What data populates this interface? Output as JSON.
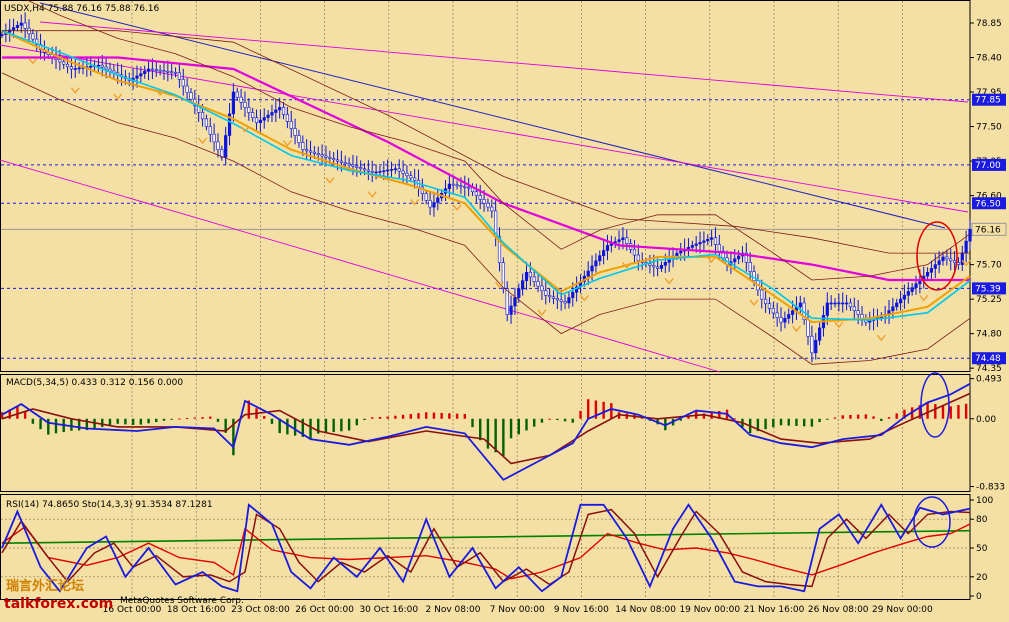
{
  "app": {
    "colors": {
      "background": "#f4e0a4",
      "grid": "#8a7a5a",
      "candle": "#0a14e0",
      "support_line": "#2020c0",
      "ma_magenta": "#e000e0",
      "ma_orange": "#f0a000",
      "ma_cyan": "#00c8e8",
      "band": "#7a1a1a",
      "fractal": "#f0a030",
      "macd_pos": "#e00000",
      "macd_neg": "#006000",
      "macd_line": "#1a1ae0",
      "signal_line": "#8a1010",
      "rsi_line": "#e00000",
      "sto_main": "#1a1ae0",
      "sto_signal": "#8a1010",
      "trend": "#008000",
      "highlight_red": "#e00000",
      "highlight_blue": "#1a1ae0"
    }
  },
  "chart_data": [
    {
      "type": "candlestick",
      "panel": "price",
      "header": "USDX,H4  75.88 76.16 75.88 76.16",
      "y_ticks": [
        "78.85",
        "78.40",
        "77.95",
        "77.50",
        "77.05",
        "76.60",
        "76.15",
        "75.70",
        "75.25",
        "74.80",
        "74.35"
      ],
      "ylim": [
        74.3,
        79.15
      ],
      "horizontal_levels": [
        {
          "value": 77.85,
          "label": "77.85"
        },
        {
          "value": 77.0,
          "label": "77.00"
        },
        {
          "value": 76.5,
          "label": "76.50"
        },
        {
          "value": 76.16,
          "label": "76.16",
          "current": true
        },
        {
          "value": 75.39,
          "label": "75.39"
        },
        {
          "value": 74.48,
          "label": "74.48"
        }
      ],
      "x_ticks": [
        "16 Oct 00:00",
        "18 Oct 16:00",
        "23 Oct 08:00",
        "26 Oct 00:00",
        "30 Oct 16:00",
        "2 Nov 08:00",
        "7 Nov 00:00",
        "9 Nov 16:00",
        "14 Nov 08:00",
        "19 Nov 00:00",
        "21 Nov 16:00",
        "26 Nov 08:00",
        "29 Nov 00:00"
      ],
      "close_path": [
        [
          0,
          78.7
        ],
        [
          5,
          78.85
        ],
        [
          10,
          78.5
        ],
        [
          18,
          78.25
        ],
        [
          25,
          78.3
        ],
        [
          33,
          78.1
        ],
        [
          38,
          78.25
        ],
        [
          45,
          78.2
        ],
        [
          52,
          77.6
        ],
        [
          57,
          77.1
        ],
        [
          60,
          77.95
        ],
        [
          66,
          77.55
        ],
        [
          72,
          77.75
        ],
        [
          78,
          77.2
        ],
        [
          84,
          77.1
        ],
        [
          90,
          77.0
        ],
        [
          96,
          76.9
        ],
        [
          102,
          76.95
        ],
        [
          107,
          76.8
        ],
        [
          111,
          76.45
        ],
        [
          116,
          76.75
        ],
        [
          121,
          76.7
        ],
        [
          127,
          76.4
        ],
        [
          131,
          75.05
        ],
        [
          136,
          75.6
        ],
        [
          141,
          75.3
        ],
        [
          146,
          75.2
        ],
        [
          151,
          75.55
        ],
        [
          157,
          75.95
        ],
        [
          161,
          76.05
        ],
        [
          165,
          75.75
        ],
        [
          170,
          75.65
        ],
        [
          175,
          75.85
        ],
        [
          179,
          75.95
        ],
        [
          184,
          76.05
        ],
        [
          188,
          75.7
        ],
        [
          192,
          75.85
        ],
        [
          197,
          75.25
        ],
        [
          202,
          74.95
        ],
        [
          207,
          75.2
        ],
        [
          210,
          74.55
        ],
        [
          214,
          75.2
        ],
        [
          219,
          75.2
        ],
        [
          224,
          74.95
        ],
        [
          229,
          75.05
        ],
        [
          234,
          75.3
        ],
        [
          239,
          75.55
        ],
        [
          244,
          75.8
        ],
        [
          248,
          75.7
        ],
        [
          251,
          76.16
        ]
      ],
      "overlays": [
        {
          "name": "MA magenta",
          "points": [
            [
              0,
              78.4
            ],
            [
              30,
              78.4
            ],
            [
              60,
              78.25
            ],
            [
              100,
              77.3
            ],
            [
              130,
              76.5
            ],
            [
              160,
              75.95
            ],
            [
              190,
              75.85
            ],
            [
              210,
              75.7
            ],
            [
              230,
              75.5
            ],
            [
              251,
              75.5
            ]
          ]
        },
        {
          "name": "MA orange",
          "points": [
            [
              0,
              78.75
            ],
            [
              15,
              78.4
            ],
            [
              30,
              78.1
            ],
            [
              45,
              77.9
            ],
            [
              60,
              77.6
            ],
            [
              75,
              77.2
            ],
            [
              90,
              76.95
            ],
            [
              105,
              76.75
            ],
            [
              120,
              76.5
            ],
            [
              130,
              75.95
            ],
            [
              145,
              75.35
            ],
            [
              155,
              75.6
            ],
            [
              170,
              75.8
            ],
            [
              185,
              75.8
            ],
            [
              200,
              75.3
            ],
            [
              210,
              74.95
            ],
            [
              225,
              75.0
            ],
            [
              240,
              75.15
            ],
            [
              251,
              75.55
            ]
          ]
        }
      ]
    },
    {
      "type": "bar",
      "panel": "macd",
      "header": "MACD(5,34,5) 0.433 0.312 0.156 0.000",
      "y_ticks": [
        "0.493",
        "0.00",
        "-0.833"
      ],
      "ylim": [
        -0.9,
        0.55
      ],
      "macd_line": [
        [
          0,
          0.05
        ],
        [
          5,
          0.18
        ],
        [
          12,
          -0.05
        ],
        [
          22,
          -0.12
        ],
        [
          35,
          -0.15
        ],
        [
          45,
          -0.1
        ],
        [
          55,
          -0.12
        ],
        [
          60,
          -0.35
        ],
        [
          63,
          0.22
        ],
        [
          70,
          0.05
        ],
        [
          80,
          -0.25
        ],
        [
          90,
          -0.32
        ],
        [
          100,
          -0.22
        ],
        [
          110,
          -0.1
        ],
        [
          120,
          -0.18
        ],
        [
          130,
          -0.75
        ],
        [
          138,
          -0.55
        ],
        [
          148,
          -0.3
        ],
        [
          152,
          0.0
        ],
        [
          158,
          0.12
        ],
        [
          165,
          0.05
        ],
        [
          172,
          -0.08
        ],
        [
          180,
          0.1
        ],
        [
          188,
          0.06
        ],
        [
          194,
          -0.2
        ],
        [
          202,
          -0.3
        ],
        [
          210,
          -0.35
        ],
        [
          218,
          -0.25
        ],
        [
          228,
          -0.2
        ],
        [
          234,
          0.02
        ],
        [
          240,
          0.2
        ],
        [
          246,
          0.3
        ],
        [
          251,
          0.43
        ]
      ],
      "signal_line": [
        [
          0,
          0.0
        ],
        [
          8,
          0.12
        ],
        [
          18,
          0.0
        ],
        [
          30,
          -0.1
        ],
        [
          45,
          -0.1
        ],
        [
          58,
          -0.15
        ],
        [
          63,
          0.05
        ],
        [
          72,
          0.1
        ],
        [
          82,
          -0.15
        ],
        [
          95,
          -0.28
        ],
        [
          110,
          -0.15
        ],
        [
          125,
          -0.25
        ],
        [
          132,
          -0.55
        ],
        [
          142,
          -0.45
        ],
        [
          152,
          -0.15
        ],
        [
          160,
          0.05
        ],
        [
          170,
          0.0
        ],
        [
          182,
          0.05
        ],
        [
          192,
          -0.05
        ],
        [
          202,
          -0.25
        ],
        [
          212,
          -0.3
        ],
        [
          225,
          -0.25
        ],
        [
          234,
          -0.05
        ],
        [
          242,
          0.12
        ],
        [
          251,
          0.31
        ]
      ]
    },
    {
      "type": "line",
      "panel": "oscillator",
      "header": "RSI(14) 74.8650  Sto(14,3,3) 91.3534 87.1281",
      "y_ticks": [
        "100",
        "80",
        "50",
        "20",
        "0"
      ],
      "ylim": [
        0,
        100
      ],
      "rsi": [
        [
          0,
          55
        ],
        [
          6,
          72
        ],
        [
          12,
          40
        ],
        [
          22,
          32
        ],
        [
          30,
          40
        ],
        [
          38,
          55
        ],
        [
          46,
          40
        ],
        [
          55,
          35
        ],
        [
          60,
          22
        ],
        [
          63,
          70
        ],
        [
          70,
          48
        ],
        [
          80,
          40
        ],
        [
          90,
          38
        ],
        [
          100,
          40
        ],
        [
          110,
          42
        ],
        [
          120,
          35
        ],
        [
          128,
          28
        ],
        [
          132,
          18
        ],
        [
          140,
          25
        ],
        [
          150,
          40
        ],
        [
          157,
          65
        ],
        [
          165,
          55
        ],
        [
          172,
          48
        ],
        [
          180,
          50
        ],
        [
          188,
          45
        ],
        [
          195,
          38
        ],
        [
          202,
          30
        ],
        [
          210,
          22
        ],
        [
          218,
          33
        ],
        [
          226,
          45
        ],
        [
          234,
          55
        ],
        [
          240,
          62
        ],
        [
          246,
          65
        ],
        [
          251,
          75
        ]
      ],
      "sto_main": [
        [
          0,
          50
        ],
        [
          4,
          88
        ],
        [
          10,
          30
        ],
        [
          15,
          5
        ],
        [
          22,
          50
        ],
        [
          27,
          62
        ],
        [
          32,
          20
        ],
        [
          38,
          50
        ],
        [
          45,
          12
        ],
        [
          52,
          25
        ],
        [
          57,
          10
        ],
        [
          61,
          5
        ],
        [
          64,
          95
        ],
        [
          70,
          75
        ],
        [
          75,
          25
        ],
        [
          80,
          8
        ],
        [
          86,
          40
        ],
        [
          92,
          20
        ],
        [
          98,
          50
        ],
        [
          104,
          15
        ],
        [
          110,
          80
        ],
        [
          116,
          20
        ],
        [
          122,
          50
        ],
        [
          128,
          8
        ],
        [
          134,
          30
        ],
        [
          140,
          5
        ],
        [
          145,
          20
        ],
        [
          150,
          95
        ],
        [
          156,
          95
        ],
        [
          162,
          60
        ],
        [
          168,
          10
        ],
        [
          174,
          70
        ],
        [
          178,
          95
        ],
        [
          184,
          60
        ],
        [
          190,
          15
        ],
        [
          196,
          10
        ],
        [
          202,
          10
        ],
        [
          208,
          5
        ],
        [
          212,
          70
        ],
        [
          217,
          85
        ],
        [
          222,
          55
        ],
        [
          228,
          95
        ],
        [
          233,
          60
        ],
        [
          238,
          92
        ],
        [
          244,
          85
        ],
        [
          251,
          91
        ]
      ],
      "sto_signal": [
        [
          0,
          45
        ],
        [
          5,
          78
        ],
        [
          12,
          40
        ],
        [
          17,
          15
        ],
        [
          24,
          45
        ],
        [
          29,
          55
        ],
        [
          34,
          30
        ],
        [
          40,
          42
        ],
        [
          47,
          20
        ],
        [
          54,
          22
        ],
        [
          59,
          15
        ],
        [
          63,
          25
        ],
        [
          66,
          85
        ],
        [
          72,
          70
        ],
        [
          77,
          35
        ],
        [
          82,
          15
        ],
        [
          88,
          35
        ],
        [
          94,
          25
        ],
        [
          100,
          42
        ],
        [
          106,
          25
        ],
        [
          112,
          70
        ],
        [
          118,
          30
        ],
        [
          124,
          45
        ],
        [
          130,
          15
        ],
        [
          136,
          28
        ],
        [
          142,
          12
        ],
        [
          147,
          25
        ],
        [
          152,
          85
        ],
        [
          158,
          90
        ],
        [
          164,
          65
        ],
        [
          170,
          20
        ],
        [
          176,
          62
        ],
        [
          180,
          88
        ],
        [
          186,
          65
        ],
        [
          192,
          25
        ],
        [
          198,
          15
        ],
        [
          204,
          12
        ],
        [
          210,
          10
        ],
        [
          214,
          60
        ],
        [
          219,
          80
        ],
        [
          224,
          60
        ],
        [
          230,
          85
        ],
        [
          235,
          65
        ],
        [
          240,
          85
        ],
        [
          246,
          88
        ],
        [
          251,
          87
        ]
      ],
      "trend_line": [
        [
          0,
          55
        ],
        [
          251,
          68
        ]
      ]
    }
  ],
  "watermark": {
    "chinese": "瑞言外汇论坛",
    "site": "talkforex.com"
  },
  "credit": "MetaQuotes Software Corp."
}
